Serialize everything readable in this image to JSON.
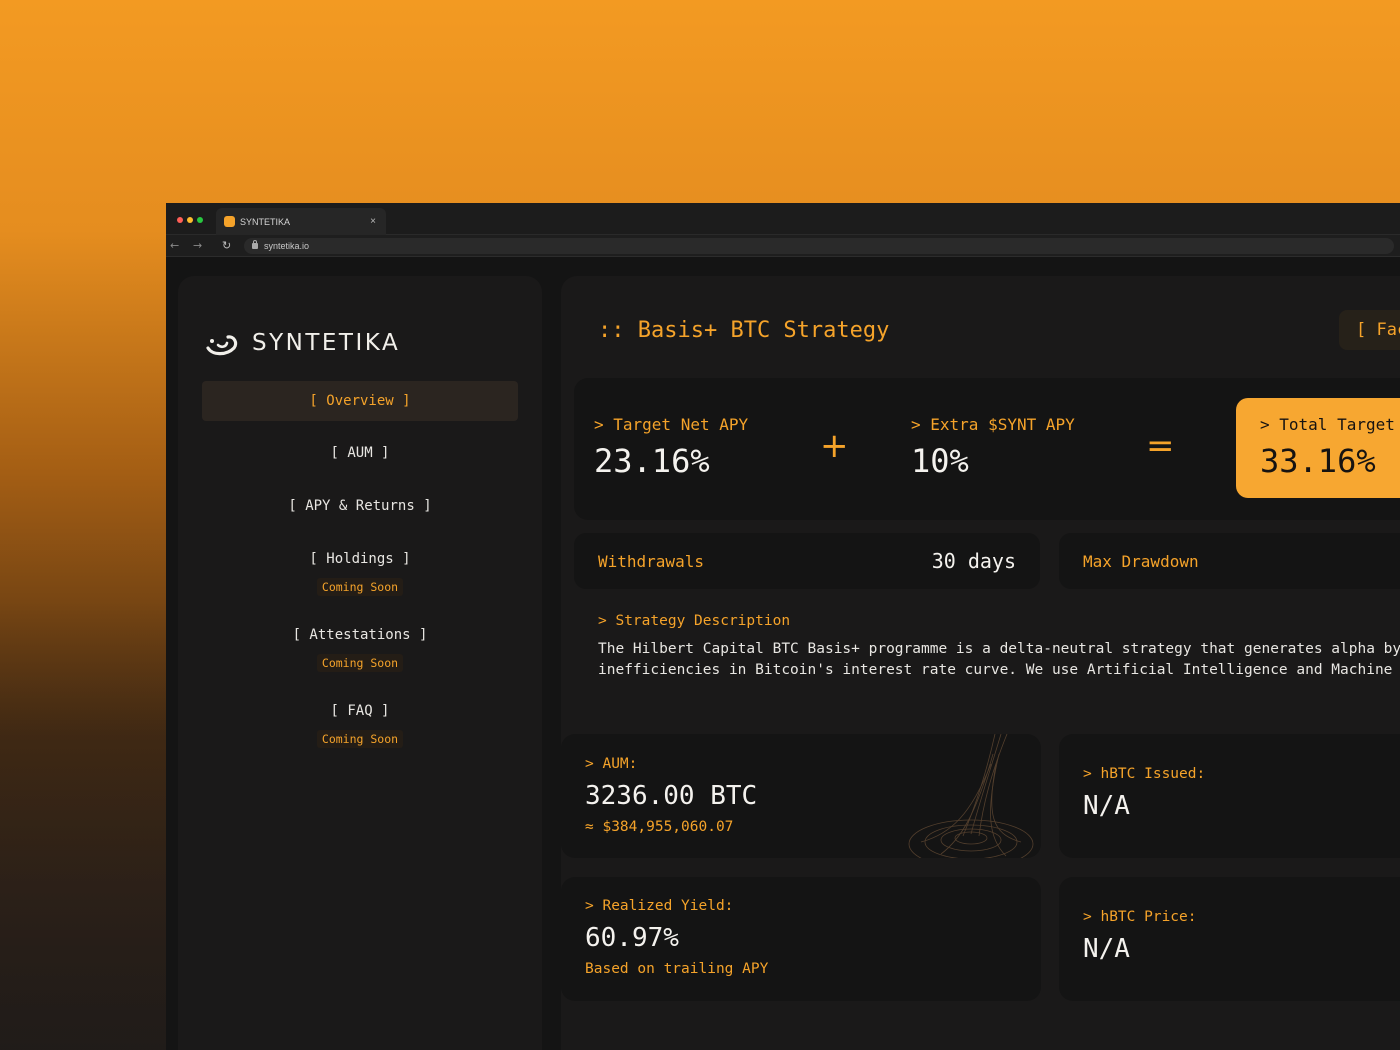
{
  "browser": {
    "tab_title": "SYNTETIKA",
    "tab_close": "×",
    "url": "syntetika.io"
  },
  "sidebar": {
    "logo_text": "SYNTETIKA",
    "items": [
      {
        "label": "[ Overview ]",
        "active": true
      },
      {
        "label": "[ AUM ]"
      },
      {
        "label": "[ APY & Returns ]"
      },
      {
        "label": "[ Holdings ]",
        "badge": "Coming Soon"
      },
      {
        "label": "[ Attestations ]",
        "badge": "Coming Soon"
      },
      {
        "label": "[ FAQ ]",
        "badge": "Coming Soon"
      }
    ]
  },
  "main": {
    "title": ":: Basis+ BTC Strategy",
    "factsheet_label": "[ Fac",
    "apy": {
      "target_label": "> Target Net APY",
      "target_value": "23.16%",
      "plus": "+",
      "extra_label": "> Extra $SYNT APY",
      "extra_value": "10%",
      "equals": "=",
      "total_label": "> Total Target",
      "total_value": "33.16%"
    },
    "withdrawals": {
      "label": "Withdrawals",
      "value": "30 days"
    },
    "max_drawdown": {
      "label": "Max Drawdown"
    },
    "description": {
      "heading": "> Strategy Description",
      "line1": "The Hilbert Capital BTC Basis+ programme is a delta-neutral strategy that generates alpha by ex",
      "line2": "inefficiencies in Bitcoin's interest rate curve. We use Artificial Intelligence and Machine Lea"
    },
    "aum": {
      "label": "> AUM:",
      "value": "3236.00 BTC",
      "sub": "≈ $384,955,060.07"
    },
    "hbtc_issued": {
      "label": "> hBTC Issued:",
      "value": "N/A"
    },
    "realized_yield": {
      "label": "> Realized Yield:",
      "value": "60.97%",
      "sub": "Based on trailing APY"
    },
    "hbtc_price": {
      "label": "> hBTC Price:",
      "value": "N/A"
    }
  },
  "colors": {
    "accent": "#f5a32a",
    "background": "#141414",
    "panel": "#1a1919",
    "text": "#f4f2ee"
  }
}
